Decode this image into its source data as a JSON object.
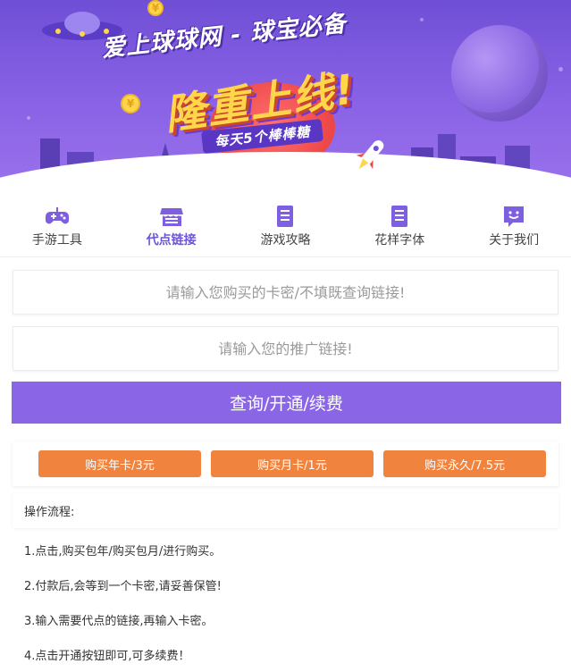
{
  "banner": {
    "headline": "爱上球球网 - 球宝必备",
    "big_text": "隆重上线!",
    "ribbon": "每天5个棒棒糖"
  },
  "nav": {
    "items": [
      {
        "label": "手游工具",
        "icon": "gamepad-icon"
      },
      {
        "label": "代点链接",
        "icon": "shop-icon",
        "active": true
      },
      {
        "label": "游戏攻略",
        "icon": "document-icon"
      },
      {
        "label": "花样字体",
        "icon": "document-icon"
      },
      {
        "label": "关于我们",
        "icon": "chat-smile-icon"
      }
    ]
  },
  "form": {
    "card_placeholder": "请输入您购买的卡密/不填既查询链接!",
    "link_placeholder": "请输入您的推广链接!",
    "submit_label": "查询/开通/续费"
  },
  "buy": {
    "year_label": "购买年卡/3元",
    "month_label": "购买月卡/1元",
    "forever_label": "购买永久/7.5元"
  },
  "steps": {
    "title": "操作流程:",
    "items": [
      "1.点击,购买包年/购买包月/进行购买。",
      "2.付款后,会等到一个卡密,请妥善保管!",
      "3.输入需要代点的链接,再输入卡密。",
      "4.点击开通按钮即可,可多续费！"
    ]
  },
  "colors": {
    "accent": "#8a66e6",
    "active_nav": "#6e55d8",
    "buy_button": "#f0843f",
    "banner_top": "#6f4fd6"
  }
}
